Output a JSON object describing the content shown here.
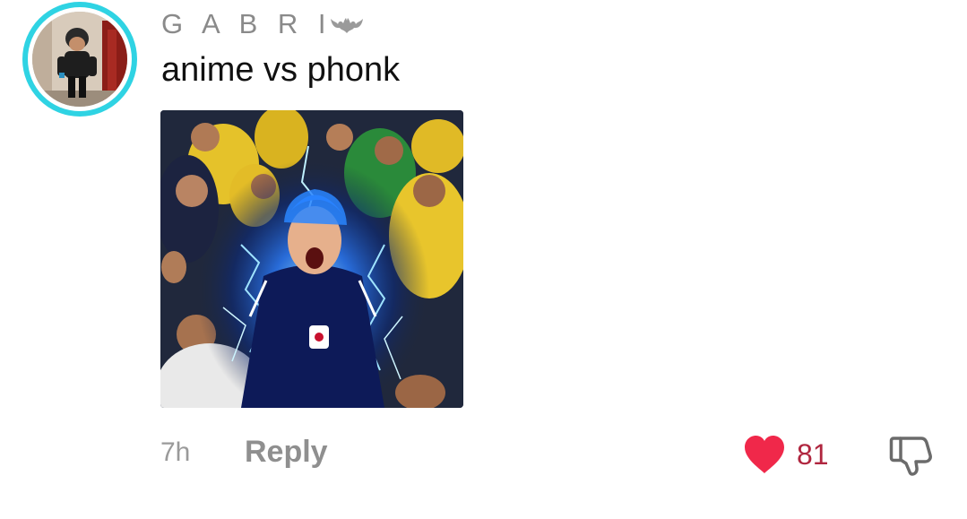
{
  "comment": {
    "username": "G A B R I",
    "text": "anime vs phonk",
    "timestamp": "7h",
    "reply_label": "Reply",
    "like_count": "81",
    "liked": true,
    "accent_colors": {
      "avatar_ring": "#2fd3e3",
      "heart": "#f0284a",
      "like_count": "#b0263f",
      "secondary_text": "#8f8f8f"
    }
  },
  "icons": {
    "badge": "bat-icon",
    "like": "heart-icon",
    "dislike": "thumbs-down-icon"
  },
  "media": {
    "kind": "image",
    "subject": "football player with blue glowing aura in crowd"
  }
}
